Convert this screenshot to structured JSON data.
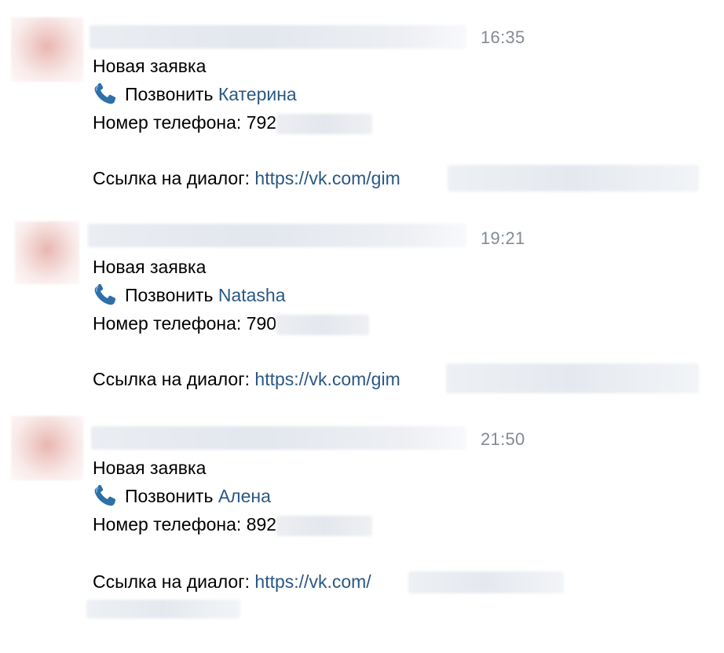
{
  "messages": [
    {
      "time": "16:35",
      "title": "Новая заявка",
      "call_label": "Позвонить",
      "contact_name": "Катерина",
      "phone_label": "Номер телефона:",
      "phone_prefix": "792",
      "dialog_label": "Ссылка на диалог:",
      "dialog_link": "https://vk.com/gim"
    },
    {
      "time": "19:21",
      "title": "Новая заявка",
      "call_label": "Позвонить",
      "contact_name": "Natasha",
      "phone_label": "Номер телефона:",
      "phone_prefix": "790",
      "dialog_label": "Ссылка на диалог:",
      "dialog_link": "https://vk.com/gim"
    },
    {
      "time": "21:50",
      "title": "Новая заявка",
      "call_label": "Позвонить",
      "contact_name": "Алена",
      "phone_label": "Номер телефона:",
      "phone_prefix": "892",
      "dialog_label": "Ссылка на диалог:",
      "dialog_link": "https://vk.com/"
    }
  ],
  "icons": {
    "call": "telephone-receiver-icon"
  },
  "colors": {
    "link": "#2a5885",
    "time": "#828a95",
    "text": "#000000"
  }
}
